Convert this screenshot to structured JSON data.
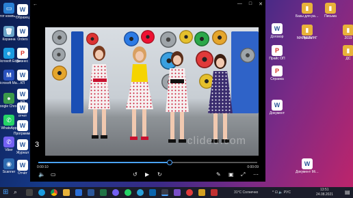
{
  "desktop_left": [
    {
      "name": "ethernet-monitor-icon",
      "label": "Этот компьютер",
      "color": "#2a7fd4",
      "glyph": "▭"
    },
    {
      "name": "recycle-bin-icon",
      "label": "Корзина",
      "color": "#6aa4c8",
      "glyph": "🗑"
    },
    {
      "name": "edge-browser-icon",
      "label": "Microsoft Edge",
      "color": "#1a9be0",
      "glyph": "e"
    },
    {
      "name": "manager-app-icon",
      "label": "Microsoft Manager",
      "color": "#2a52be",
      "glyph": "M"
    },
    {
      "name": "chrome-browser-icon",
      "label": "Google Chrome",
      "color": "#3c9a4a",
      "glyph": "●"
    },
    {
      "name": "whatsapp-icon",
      "label": "WhatsApp",
      "color": "#25d366",
      "glyph": "✆"
    },
    {
      "name": "viber-icon",
      "label": "Viber",
      "color": "#7360f2",
      "glyph": "✆"
    },
    {
      "name": "scanner-icon",
      "label": "Scanner",
      "color": "#2d6ab0",
      "glyph": "◉"
    }
  ],
  "desktop_mid": [
    {
      "name": "word-doc-icon-1",
      "label": "Образец",
      "color": "#ffffff",
      "text_color": "#2b579a",
      "glyph": "W"
    },
    {
      "name": "word-doc-icon-2",
      "label": "Orders",
      "color": "#ffffff",
      "text_color": "#2b579a",
      "glyph": "W"
    },
    {
      "name": "pdf-icon-1",
      "label": "Бизнес",
      "color": "#ffffff",
      "text_color": "#d93025",
      "glyph": "P"
    },
    {
      "name": "word-doc-icon-3",
      "label": "КП",
      "color": "#ffffff",
      "text_color": "#2b579a",
      "glyph": "W"
    },
    {
      "name": "word-doc-icon-4",
      "label": "КЛ",
      "color": "#ffffff",
      "text_color": "#2b579a",
      "glyph": "W"
    },
    {
      "name": "word-doc-icon-5",
      "label": "отчет",
      "color": "#ffffff",
      "text_color": "#2b579a",
      "glyph": "W"
    },
    {
      "name": "word-doc-icon-6",
      "label": "Программа",
      "color": "#ffffff",
      "text_color": "#2b579a",
      "glyph": "W"
    },
    {
      "name": "word-doc-icon-7",
      "label": "Журнал",
      "color": "#ffffff",
      "text_color": "#2b579a",
      "glyph": "W"
    },
    {
      "name": "word-doc-icon-8",
      "label": "Отчёт",
      "color": "#ffffff",
      "text_color": "#2b579a",
      "glyph": "W"
    }
  ],
  "desktop_right": [
    {
      "name": "folder-icon-1",
      "label": "Базы для рассылки",
      "color": "#e8b23a",
      "glyph": "▮"
    },
    {
      "name": "folder-icon-2",
      "label": "Письма",
      "color": "#e8b23a",
      "glyph": "▮"
    },
    {
      "name": "pdf-icon-2",
      "label": "Прайс",
      "color": "#ffffff",
      "text_color": "#d93025",
      "glyph": "P"
    },
    {
      "name": "folder-icon-3",
      "label": "МАРКЕТИНГ",
      "color": "#e8b23a",
      "glyph": "▮"
    },
    {
      "name": "word-doc-icon-9",
      "label": "Договор",
      "color": "#ffffff",
      "text_color": "#2b579a",
      "glyph": "W"
    },
    {
      "name": "pdf-icon-3",
      "label": "Прайс ОП",
      "color": "#ffffff",
      "text_color": "#d93025",
      "glyph": "P"
    },
    {
      "name": "pdf-icon-4",
      "label": "Справка",
      "color": "#ffffff",
      "text_color": "#d93025",
      "glyph": "P"
    },
    {
      "name": "word-doc-icon-10",
      "label": "Документ",
      "color": "#ffffff",
      "text_color": "#2b579a",
      "glyph": "W"
    },
    {
      "name": "folder-icon-4",
      "label": "2019",
      "color": "#e8b23a",
      "glyph": "▮"
    },
    {
      "name": "folder-icon-5",
      "label": "ДС",
      "color": "#e8b23a",
      "glyph": "▮"
    },
    {
      "name": "word-doc-icon-11",
      "label": "Документ Microsoft Word",
      "color": "#ffffff",
      "text_color": "#2b579a",
      "glyph": "W"
    }
  ],
  "player": {
    "title_back": "←",
    "win_min": "—",
    "win_max": "□",
    "win_close": "✕",
    "overlay_number": "3",
    "watermark": "clideo.com",
    "time_current": "0:00:10",
    "time_total": "0:00:09",
    "progress": 0.6,
    "controls": {
      "volume": "🔈",
      "captions": "▭",
      "rewind": "↺",
      "play": "▶",
      "forward": "↻",
      "edit": "✎",
      "miniview": "▣",
      "fullscreen": "⤢",
      "more": "⋯"
    },
    "accent": "#4aa3ff"
  },
  "taskbar": {
    "start": "⊞",
    "search": "⌕",
    "weather": "31°C Солнечно",
    "tray": "^ ⊡ 🔈 РУС",
    "time": "13:51",
    "date": "24.08.2021",
    "notifications": "▤"
  }
}
